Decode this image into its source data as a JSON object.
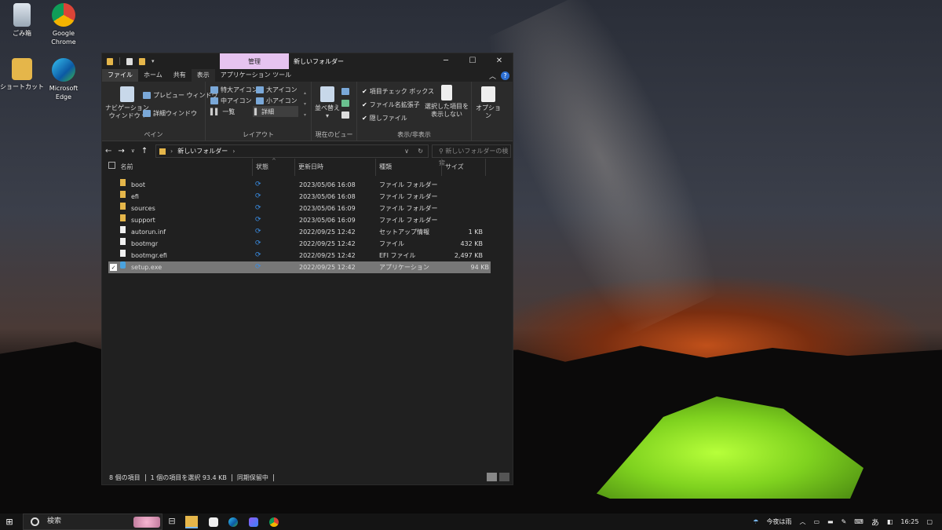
{
  "desktop": {
    "icons": [
      {
        "label1": "ごみ箱",
        "label2": ""
      },
      {
        "label1": "Google",
        "label2": "Chrome"
      },
      {
        "label1": "ショートカット",
        "label2": ""
      },
      {
        "label1": "Microsoft",
        "label2": "Edge"
      }
    ]
  },
  "window": {
    "context_tab": "管理",
    "title": "新しいフォルダー",
    "controls": {
      "minimize": "─",
      "maximize": "☐",
      "close": "✕"
    },
    "tabs": [
      "ファイル",
      "ホーム",
      "共有",
      "表示",
      "アプリケーション ツール"
    ],
    "ribbon": {
      "pane": {
        "nav_pane_1": "ナビゲーション",
        "nav_pane_2": "ウィンドウ ▾",
        "preview": "プレビュー ウィンドウ",
        "details": "詳細ウィンドウ",
        "label": "ペイン"
      },
      "layout": {
        "xlarge": "特大アイコン",
        "large": "大アイコン",
        "medium": "中アイコン",
        "small": "小アイコン",
        "list": "一覧",
        "detail": "詳細",
        "label": "レイアウト"
      },
      "view": {
        "sort": "並べ替え",
        "label": "現在のビュー"
      },
      "showhide": {
        "item_checkbox": "項目チェック ボックス",
        "extensions": "ファイル名拡張子",
        "hidden": "隠しファイル",
        "hide_selected_1": "選択した項目を",
        "hide_selected_2": "表示しない",
        "label": "表示/非表示"
      },
      "options": "オプション"
    },
    "address": {
      "path": "新しいフォルダー",
      "search_placeholder": "新しいフォルダーの検索"
    },
    "columns": [
      "名前",
      "状態",
      "更新日時",
      "種類",
      "サイズ"
    ],
    "files": [
      {
        "name": "boot",
        "date": "2023/05/06 16:08",
        "type": "ファイル フォルダー",
        "size": "",
        "icon": "folder"
      },
      {
        "name": "efi",
        "date": "2023/05/06 16:08",
        "type": "ファイル フォルダー",
        "size": "",
        "icon": "folder"
      },
      {
        "name": "sources",
        "date": "2023/05/06 16:09",
        "type": "ファイル フォルダー",
        "size": "",
        "icon": "folder"
      },
      {
        "name": "support",
        "date": "2023/05/06 16:09",
        "type": "ファイル フォルダー",
        "size": "",
        "icon": "folder"
      },
      {
        "name": "autorun.inf",
        "date": "2022/09/25 12:42",
        "type": "セットアップ情報",
        "size": "1 KB",
        "icon": "doc"
      },
      {
        "name": "bootmgr",
        "date": "2022/09/25 12:42",
        "type": "ファイル",
        "size": "432 KB",
        "icon": "doc"
      },
      {
        "name": "bootmgr.efi",
        "date": "2022/09/25 12:42",
        "type": "EFI ファイル",
        "size": "2,497 KB",
        "icon": "doc"
      },
      {
        "name": "setup.exe",
        "date": "2022/09/25 12:42",
        "type": "アプリケーション",
        "size": "94 KB",
        "icon": "exe"
      }
    ],
    "status": {
      "count": "8 個の項目",
      "selected": "1 個の項目を選択  93.4 KB",
      "sync": "同期保留中"
    }
  },
  "taskbar": {
    "search": "検索",
    "weather": "今夜は雨",
    "ime": "あ",
    "time": "16:25"
  }
}
